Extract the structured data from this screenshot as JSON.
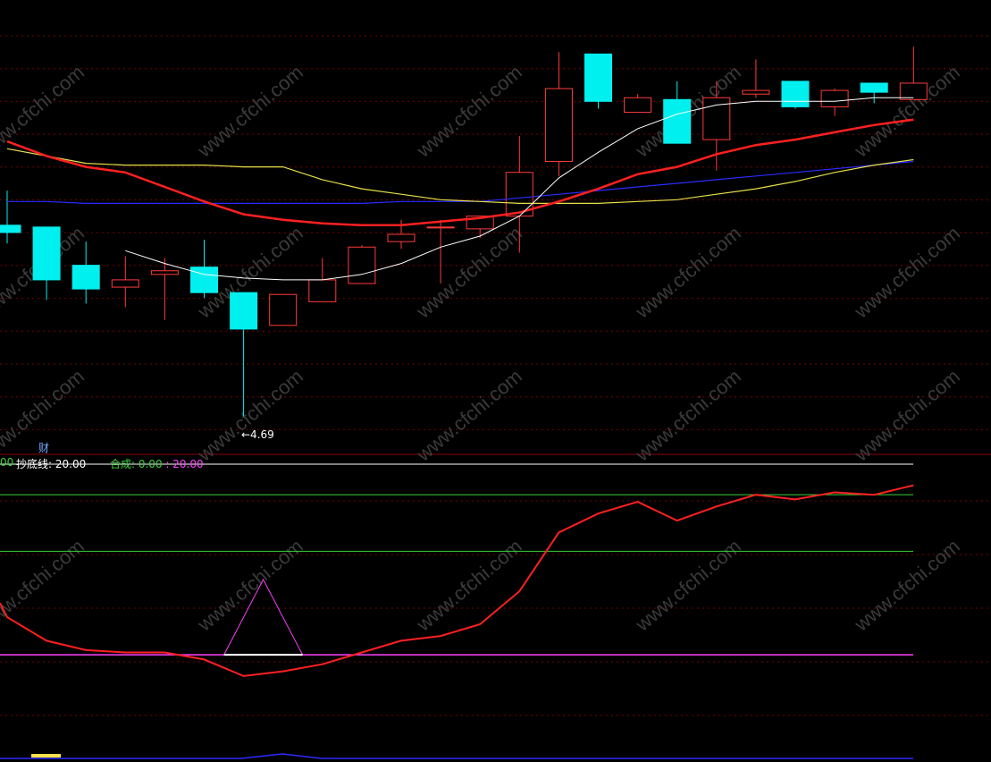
{
  "watermark": "www.cfchi.com",
  "colors": {
    "up": "#ff3b3b",
    "down": "#00f0f0",
    "ma_short": "#ffffff",
    "ma_mid": "#ff2020",
    "ma_long_yellow": "#e6e04a",
    "ma_long_blue": "#2b2bff",
    "grid": "#7a0000",
    "divider": "#8b0000",
    "indicator_line": "#ff2020",
    "level_white": "#ffffff",
    "level_green": "#3bd13b",
    "level_magenta": "#ff40ff",
    "text_white": "#ffffff",
    "text_green": "#3bd13b",
    "text_magenta": "#ff40ff"
  },
  "labels": {
    "fin_icon": "财",
    "legend_prefix": "00",
    "bottom_line_label": "抄底线: 20.00",
    "composite_label": "合成: ",
    "composite_value": "0.00",
    "composite_sep": " : ",
    "composite_level": "20.00",
    "low_marker": "←4.69"
  },
  "chart_data": {
    "type": "candlestick",
    "candles": [
      {
        "o": 5.74,
        "c": 5.7,
        "h": 5.93,
        "l": 5.64
      },
      {
        "o": 5.73,
        "c": 5.44,
        "h": 5.73,
        "l": 5.33
      },
      {
        "o": 5.52,
        "c": 5.39,
        "h": 5.65,
        "l": 5.31
      },
      {
        "o": 5.4,
        "c": 5.44,
        "h": 5.57,
        "l": 5.29
      },
      {
        "o": 5.47,
        "c": 5.49,
        "h": 5.56,
        "l": 5.22
      },
      {
        "o": 5.51,
        "c": 5.37,
        "h": 5.66,
        "l": 5.34
      },
      {
        "o": 5.37,
        "c": 5.17,
        "h": 5.37,
        "l": 4.69
      },
      {
        "o": 5.19,
        "c": 5.36,
        "h": 5.36,
        "l": 5.19
      },
      {
        "o": 5.32,
        "c": 5.44,
        "h": 5.56,
        "l": 5.32
      },
      {
        "o": 5.42,
        "c": 5.62,
        "h": 5.63,
        "l": 5.42
      },
      {
        "o": 5.65,
        "c": 5.69,
        "h": 5.77,
        "l": 5.61
      },
      {
        "o": 5.73,
        "c": 5.73,
        "h": 5.77,
        "l": 5.42
      },
      {
        "o": 5.72,
        "c": 5.79,
        "h": 5.79,
        "l": 5.67
      },
      {
        "o": 5.79,
        "c": 6.03,
        "h": 6.23,
        "l": 5.59
      },
      {
        "o": 6.09,
        "c": 6.49,
        "h": 6.69,
        "l": 6.01
      },
      {
        "o": 6.68,
        "c": 6.42,
        "h": 6.68,
        "l": 6.38
      },
      {
        "o": 6.36,
        "c": 6.44,
        "h": 6.46,
        "l": 6.36
      },
      {
        "o": 6.43,
        "c": 6.19,
        "h": 6.53,
        "l": 6.19
      },
      {
        "o": 6.21,
        "c": 6.44,
        "h": 6.53,
        "l": 6.04
      },
      {
        "o": 6.46,
        "c": 6.48,
        "h": 6.65,
        "l": 6.44
      },
      {
        "o": 6.53,
        "c": 6.39,
        "h": 6.53,
        "l": 6.38
      },
      {
        "o": 6.39,
        "c": 6.48,
        "h": 6.49,
        "l": 6.34
      },
      {
        "o": 6.52,
        "c": 6.47,
        "h": 6.52,
        "l": 6.41
      },
      {
        "o": 6.43,
        "c": 6.52,
        "h": 6.72,
        "l": 6.43
      }
    ],
    "ma_short": [
      null,
      null,
      null,
      5.6,
      5.53,
      5.47,
      5.45,
      5.44,
      5.44,
      5.47,
      5.53,
      5.62,
      5.68,
      5.79,
      6.0,
      6.14,
      6.27,
      6.35,
      6.4,
      6.42,
      6.42,
      6.42,
      6.44,
      6.44
    ],
    "ma_mid": [
      6.2,
      6.12,
      6.06,
      6.03,
      5.95,
      5.87,
      5.8,
      5.77,
      5.75,
      5.74,
      5.74,
      5.76,
      5.78,
      5.81,
      5.87,
      5.94,
      6.02,
      6.06,
      6.13,
      6.18,
      6.21,
      6.25,
      6.29,
      6.32
    ],
    "ma_long_yellow": [
      6.16,
      6.12,
      6.08,
      6.07,
      6.07,
      6.07,
      6.06,
      6.06,
      5.99,
      5.94,
      5.91,
      5.88,
      5.87,
      5.86,
      5.86,
      5.86,
      5.87,
      5.88,
      5.91,
      5.94,
      5.98,
      6.03,
      6.07,
      6.1
    ],
    "ma_long_blue": [
      5.87,
      5.87,
      5.86,
      5.86,
      5.86,
      5.86,
      5.86,
      5.86,
      5.86,
      5.86,
      5.87,
      5.87,
      5.87,
      5.89,
      5.91,
      5.93,
      5.95,
      5.97,
      5.99,
      6.01,
      6.03,
      6.05,
      6.07,
      6.09
    ],
    "indicator": {
      "series": [
        {
          "name": "合成",
          "values": [
            36,
            26,
            22,
            21,
            21,
            18,
            11,
            13,
            16,
            21,
            26,
            28,
            33,
            47,
            72,
            80,
            85,
            77,
            83,
            88,
            86,
            89,
            88,
            92
          ]
        }
      ],
      "levels": {
        "white": 101,
        "green_upper": 88,
        "green_lower": 64,
        "magenta": 20
      },
      "pulse": {
        "candle_index": 6,
        "peak": 52
      }
    }
  }
}
